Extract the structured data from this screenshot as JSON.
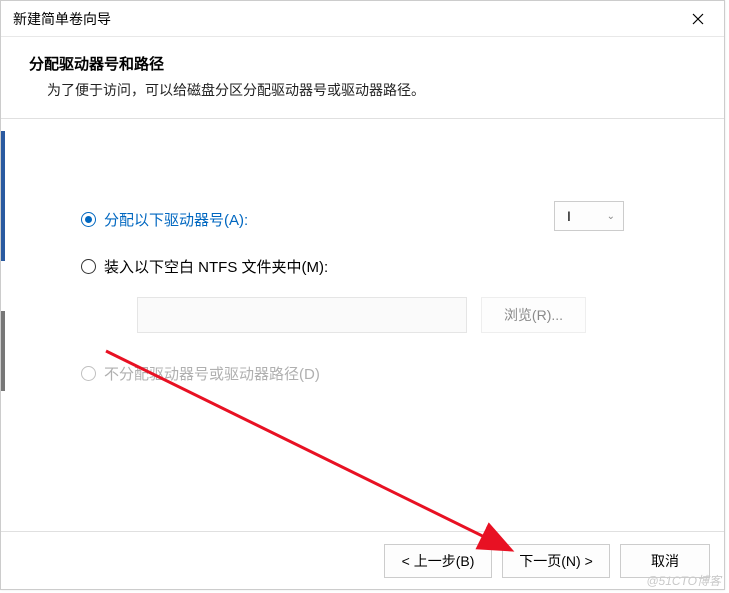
{
  "window": {
    "title": "新建简单卷向导"
  },
  "header": {
    "title": "分配驱动器号和路径",
    "subtitle": "为了便于访问，可以给磁盘分区分配驱动器号或驱动器路径。"
  },
  "options": {
    "assign_letter_label": "分配以下驱动器号(A):",
    "selected_drive": "I",
    "mount_folder_label": "装入以下空白 NTFS 文件夹中(M):",
    "mount_path_value": "",
    "browse_label": "浏览(R)...",
    "no_assign_label": "不分配驱动器号或驱动器路径(D)"
  },
  "footer": {
    "back_label": "< 上一步(B)",
    "next_label": "下一页(N) >",
    "cancel_label": "取消"
  },
  "watermark": "@51CTO博客"
}
